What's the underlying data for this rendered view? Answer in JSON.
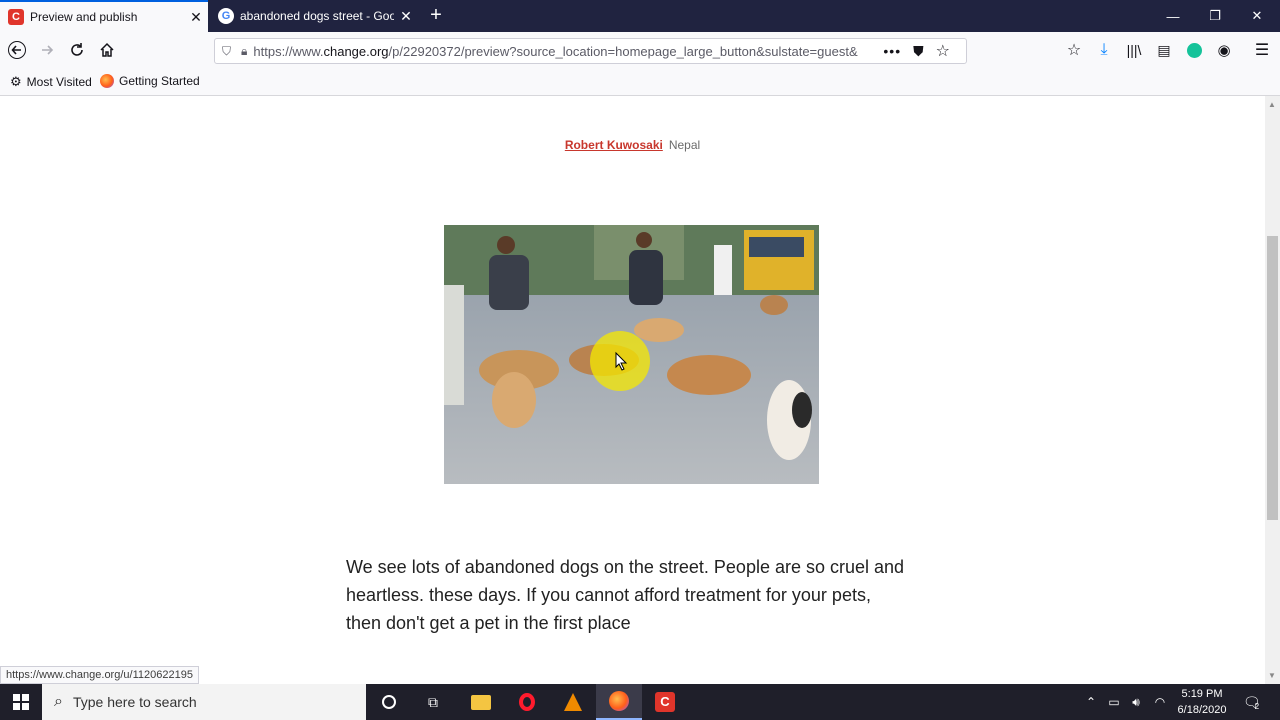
{
  "browser": {
    "tabs": [
      {
        "title": "Preview and publish",
        "active": true,
        "favicon": "change-org-icon"
      },
      {
        "title": "abandoned dogs street - Goog",
        "active": false,
        "favicon": "google-icon"
      }
    ],
    "new_tab_label": "+",
    "window_controls": {
      "minimize": "—",
      "restore": "❐",
      "close": "✕"
    },
    "url": {
      "prefix": "https://www.",
      "domain": "change.org",
      "path": "/p/22920372/preview?source_location=homepage_large_button&sulstate=guest&"
    },
    "bookmarks": [
      {
        "label": "Most Visited",
        "icon": "gear-icon"
      },
      {
        "label": "Getting Started",
        "icon": "firefox-icon"
      }
    ]
  },
  "page": {
    "author": "Robert Kuwosaki",
    "location": "Nepal",
    "body": "We see lots of abandoned dogs on the street. People are so cruel and heartless.  these days. If you cannot afford treatment for your pets, then don't get a pet in the first place"
  },
  "status_link": "https://www.change.org/u/1120622195",
  "taskbar": {
    "search_placeholder": "Type here to search",
    "time": "5:19 PM",
    "date": "6/18/2020",
    "notification_count": "2"
  },
  "colors": {
    "accent": "#c8372d",
    "tabstrip": "#202340",
    "taskbar": "#1f1f2a",
    "cursor_highlight": "#f5e800"
  }
}
